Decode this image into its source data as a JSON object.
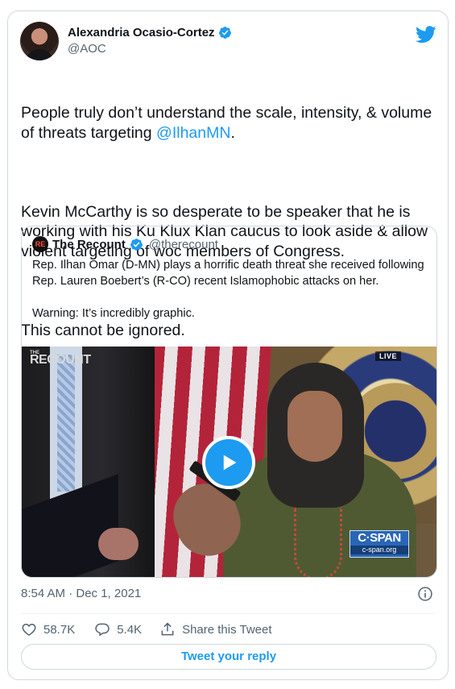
{
  "author": {
    "display_name": "Alexandria Ocasio-Cortez",
    "handle": "@AOC",
    "avatar_icon": "profile-photo",
    "verified_icon": "verified-badge-icon"
  },
  "brand_icon": "twitter-bird-icon",
  "tweet": {
    "para1_before": "People truly don’t understand the scale, intensity, & volume of threats targeting ",
    "para1_mention": "@IlhanMN",
    "para1_after": ".",
    "para2": "Kevin McCarthy is so desperate to be speaker that he is working with his Ku Klux Klan caucus to look aside & allow violent targeting of woc members of Congress.",
    "para3": "This cannot be ignored."
  },
  "quoted": {
    "avatar_text": "RE",
    "display_name": "The Recount",
    "handle": "@therecount",
    "text1": "Rep. Ilhan Omar (D-MN) plays a horrific death threat she received following Rep. Lauren Boebert’s (R-CO) recent Islamophobic attacks on her.",
    "text2": "Warning: It’s incredibly graphic.",
    "media": {
      "watermark_small": "THE",
      "watermark": "RECOUNT",
      "live_badge": "LIVE",
      "network_logo": "C·SPAN",
      "network_url": "c-span.org"
    }
  },
  "timestamp": "8:54 AM · Dec 1, 2021",
  "actions": {
    "likes": "58.7K",
    "replies": "5.4K",
    "share_label": "Share this Tweet"
  },
  "reply_button": "Tweet your reply",
  "colors": {
    "accent": "#1d9bf0",
    "secondary_text": "#536471",
    "border": "#cfd9de"
  }
}
